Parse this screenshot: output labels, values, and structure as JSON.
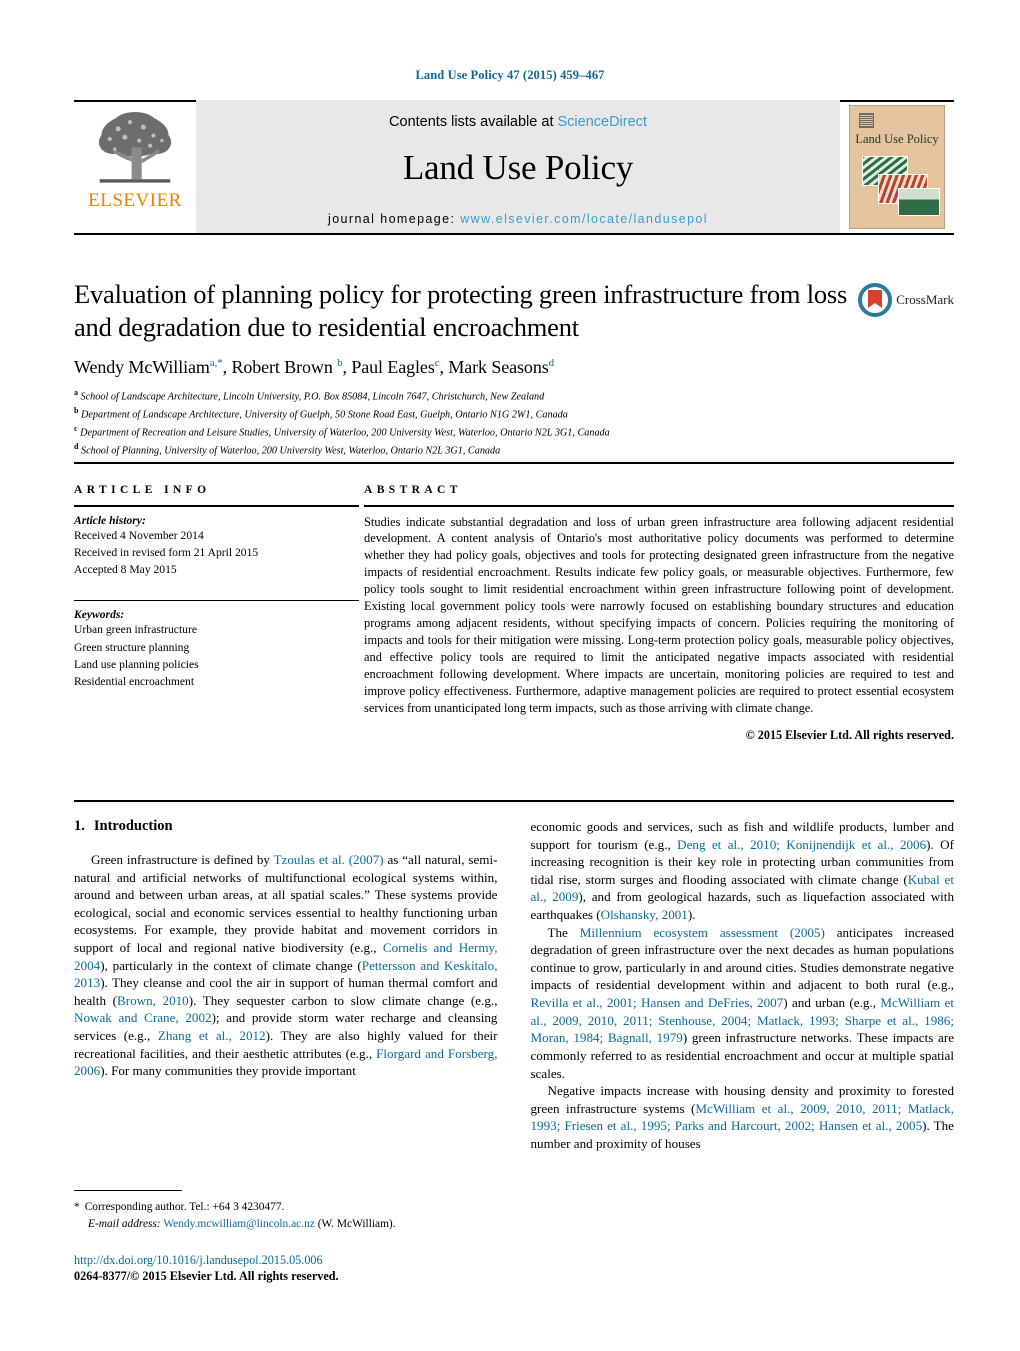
{
  "running_head": "Land Use Policy 47 (2015) 459–467",
  "journal_header": {
    "contents_prefix": "Contents lists available at ",
    "sciencedirect": "ScienceDirect",
    "journal_title": "Land Use Policy",
    "homepage_prefix": "journal homepage: ",
    "homepage_url": "www.elsevier.com/locate/landusepol",
    "publisher_wordmark": "ELSEVIER",
    "publisher_icon": "elsevier-tree-icon",
    "cover_title": "Land Use Policy",
    "accent_link_color": "#3a9bd5",
    "publisher_orange": "#f08000",
    "band_bg": "#e8e8e8"
  },
  "article": {
    "title": "Evaluation of planning policy for protecting green infrastructure from loss and degradation due to residential encroachment",
    "authors_parts": [
      {
        "name": "Wendy McWilliam",
        "sup": "a,*"
      },
      {
        "name": ", Robert Brown ",
        "sup": "b"
      },
      {
        "name": ", Paul Eagles",
        "sup": "c"
      },
      {
        "name": ", Mark Seasons",
        "sup": "d"
      }
    ],
    "affiliations": [
      {
        "marker": "a",
        "text": "School of Landscape Architecture, Lincoln University, P.O. Box 85084, Lincoln 7647, Christchurch, New Zealand"
      },
      {
        "marker": "b",
        "text": "Department of Landscape Architecture, University of Guelph, 50 Stone Road East, Guelph, Ontario N1G 2W1, Canada"
      },
      {
        "marker": "c",
        "text": "Department of Recreation and Leisure Studies, University of Waterloo, 200 University West, Waterloo, Ontario N2L 3G1, Canada"
      },
      {
        "marker": "d",
        "text": "School of Planning, University of Waterloo, 200 University West, Waterloo, Ontario N2L 3G1, Canada"
      }
    ],
    "crossmark_label": "CrossMark"
  },
  "article_info": {
    "heading": "ARTICLE INFO",
    "history_label": "Article history:",
    "history": [
      "Received 4 November 2014",
      "Received in revised form 21 April 2015",
      "Accepted 8 May 2015"
    ],
    "keywords_label": "Keywords:",
    "keywords": [
      "Urban green infrastructure",
      "Green structure planning",
      "Land use planning policies",
      "Residential encroachment"
    ]
  },
  "abstract": {
    "heading": "ABSTRACT",
    "text": "Studies indicate substantial degradation and loss of urban green infrastructure area following adjacent residential development. A content analysis of Ontario's most authoritative policy documents was performed to determine whether they had policy goals, objectives and tools for protecting designated green infrastructure from the negative impacts of residential encroachment. Results indicate few policy goals, or measurable objectives. Furthermore, few policy tools sought to limit residential encroachment within green infrastructure following point of development. Existing local government policy tools were narrowly focused on establishing boundary structures and education programs among adjacent residents, without specifying impacts of concern. Policies requiring the monitoring of impacts and tools for their mitigation were missing. Long-term protection policy goals, measurable policy objectives, and effective policy tools are required to limit the anticipated negative impacts associated with residential encroachment following development. Where impacts are uncertain, monitoring policies are required to test and improve policy effectiveness. Furthermore, adaptive management policies are required to protect essential ecosystem services from unanticipated long term impacts, such as those arriving with climate change.",
    "copyright": "© 2015 Elsevier Ltd. All rights reserved."
  },
  "introduction": {
    "number": "1.",
    "heading": "Introduction",
    "left_paragraph_1_segments": [
      {
        "t": "Green infrastructure is defined by ",
        "link": false
      },
      {
        "t": "Tzoulas et al. (2007)",
        "link": true
      },
      {
        "t": " as “all natural, semi-natural and artificial networks of multifunctional ecological systems within, around and between urban areas, at all spatial scales.” These systems provide ecological, social and economic services essential to healthy functioning urban ecosystems. For example, they provide habitat and movement corridors in support of local and regional native biodiversity (e.g., ",
        "link": false
      },
      {
        "t": "Cornelis and Hermy, 2004",
        "link": true
      },
      {
        "t": "), particularly in the context of climate change (",
        "link": false
      },
      {
        "t": "Pettersson and Keskitalo, 2013",
        "link": true
      },
      {
        "t": "). They cleanse and cool the air in support of human thermal comfort and health (",
        "link": false
      },
      {
        "t": "Brown, 2010",
        "link": true
      },
      {
        "t": "). They sequester carbon to slow climate change (e.g., ",
        "link": false
      },
      {
        "t": "Nowak and Crane, 2002",
        "link": true
      },
      {
        "t": "); and provide storm water recharge and cleansing services (e.g., ",
        "link": false
      },
      {
        "t": "Zhang et al., 2012",
        "link": true
      },
      {
        "t": "). They are also highly valued for their recreational facilities, and their aesthetic attributes (e.g., ",
        "link": false
      },
      {
        "t": "Florgard and Forsberg, 2006",
        "link": true
      },
      {
        "t": "). For many communities they provide important",
        "link": false
      }
    ],
    "right_paragraph_1_segments": [
      {
        "t": "economic goods and services, such as fish and wildlife products, lumber and support for tourism (e.g., ",
        "link": false
      },
      {
        "t": "Deng et al., 2010; Konijnendijk et al., 2006",
        "link": true
      },
      {
        "t": "). Of increasing recognition is their key role in protecting urban communities from tidal rise, storm surges and flooding associated with climate change (",
        "link": false
      },
      {
        "t": "Kubal et al., 2009",
        "link": true
      },
      {
        "t": "), and from geological hazards, such as liquefaction associated with earthquakes (",
        "link": false
      },
      {
        "t": "Olshansky, 2001",
        "link": true
      },
      {
        "t": ").",
        "link": false
      }
    ],
    "right_paragraph_2_segments": [
      {
        "t": "The ",
        "link": false
      },
      {
        "t": "Millennium ecosystem assessment (2005)",
        "link": true
      },
      {
        "t": " anticipates increased degradation of green infrastructure over the next decades as human populations continue to grow, particularly in and around cities. Studies demonstrate negative impacts of residential development within and adjacent to both rural (e.g., ",
        "link": false
      },
      {
        "t": "Revilla et al., 2001; Hansen and DeFries, 2007",
        "link": true
      },
      {
        "t": ") and urban (e.g., ",
        "link": false
      },
      {
        "t": "McWilliam et al., 2009, 2010, 2011; Stenhouse, 2004; Matlack, 1993; Sharpe et al., 1986; Moran, 1984; Bagnall, 1979",
        "link": true
      },
      {
        "t": ") green infrastructure networks. These impacts are commonly referred to as residential encroachment and occur at multiple spatial scales.",
        "link": false
      }
    ],
    "right_paragraph_3_segments": [
      {
        "t": "Negative impacts increase with housing density and proximity to forested green infrastructure systems (",
        "link": false
      },
      {
        "t": "McWilliam et al., 2009, 2010, 2011; Matlack, 1993; Friesen et al., 1995; Parks and Harcourt, 2002; Hansen et al., 2005",
        "link": true
      },
      {
        "t": "). The number and proximity of houses",
        "link": false
      }
    ]
  },
  "footnote": {
    "corresponding_star": "*",
    "corresponding_text": "Corresponding author. Tel.: +64 3 4230477.",
    "email_label": "E-mail address:",
    "email": "Wendy.mcwilliam@lincoln.ac.nz",
    "email_owner": "(W. McWilliam)."
  },
  "footer": {
    "doi": "http://dx.doi.org/10.1016/j.landusepol.2015.05.006",
    "issn_line": "0264-8377/© 2015 Elsevier Ltd. All rights reserved."
  },
  "colors": {
    "link": "#0b6a9a",
    "sciencedirect": "#3a9bd5",
    "elsevier_orange": "#f08000"
  }
}
